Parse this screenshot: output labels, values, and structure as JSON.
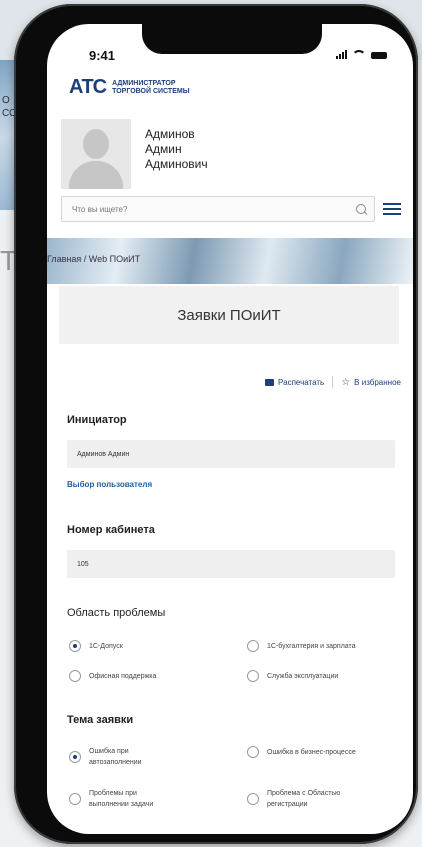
{
  "status_bar": {
    "time": "9:41"
  },
  "background": {
    "left_fragment_1": "О",
    "left_fragment_2": "СО",
    "left_big": "Т"
  },
  "logo": {
    "mark": "АТС",
    "line1": "АДМИНИСТРАТОР",
    "line2": "ТОРГОВОЙ СИСТЕМЫ"
  },
  "user": {
    "last_name": "Админов",
    "first_name": "Админ",
    "patronymic": "Админович"
  },
  "search": {
    "placeholder": "Что вы ищете?"
  },
  "breadcrumb": "Главная / Web ПОиИТ",
  "page_title": "Заявки ПОиИТ",
  "actions": {
    "print": "Распечатать",
    "favorite": "В избранное"
  },
  "initiator": {
    "label": "Инициатор",
    "value": "Админов Админ",
    "select_link": "Выбор пользователя"
  },
  "office": {
    "label": "Номер кабинета",
    "value": "105"
  },
  "problem_area": {
    "label": "Область проблемы",
    "options": [
      "1С-Допуск",
      "1С-бухгалтерия и зарплата",
      "Офисная поддержка",
      "Служба эксплуатации"
    ],
    "selected": "1С-Допуск"
  },
  "request_topic": {
    "label": "Тема заявки",
    "options": [
      "Ошибка при автозаполнении",
      "Ошибка в бизнес-процессе",
      "Проблемы при выполнении задачи",
      "Проблема с Областью регистрации"
    ],
    "selected": "Ошибка при автозаполнении"
  },
  "colors": {
    "brand_blue": "#1b3f7a",
    "brand_red": "#d9232d",
    "link": "#1b5fa8"
  }
}
